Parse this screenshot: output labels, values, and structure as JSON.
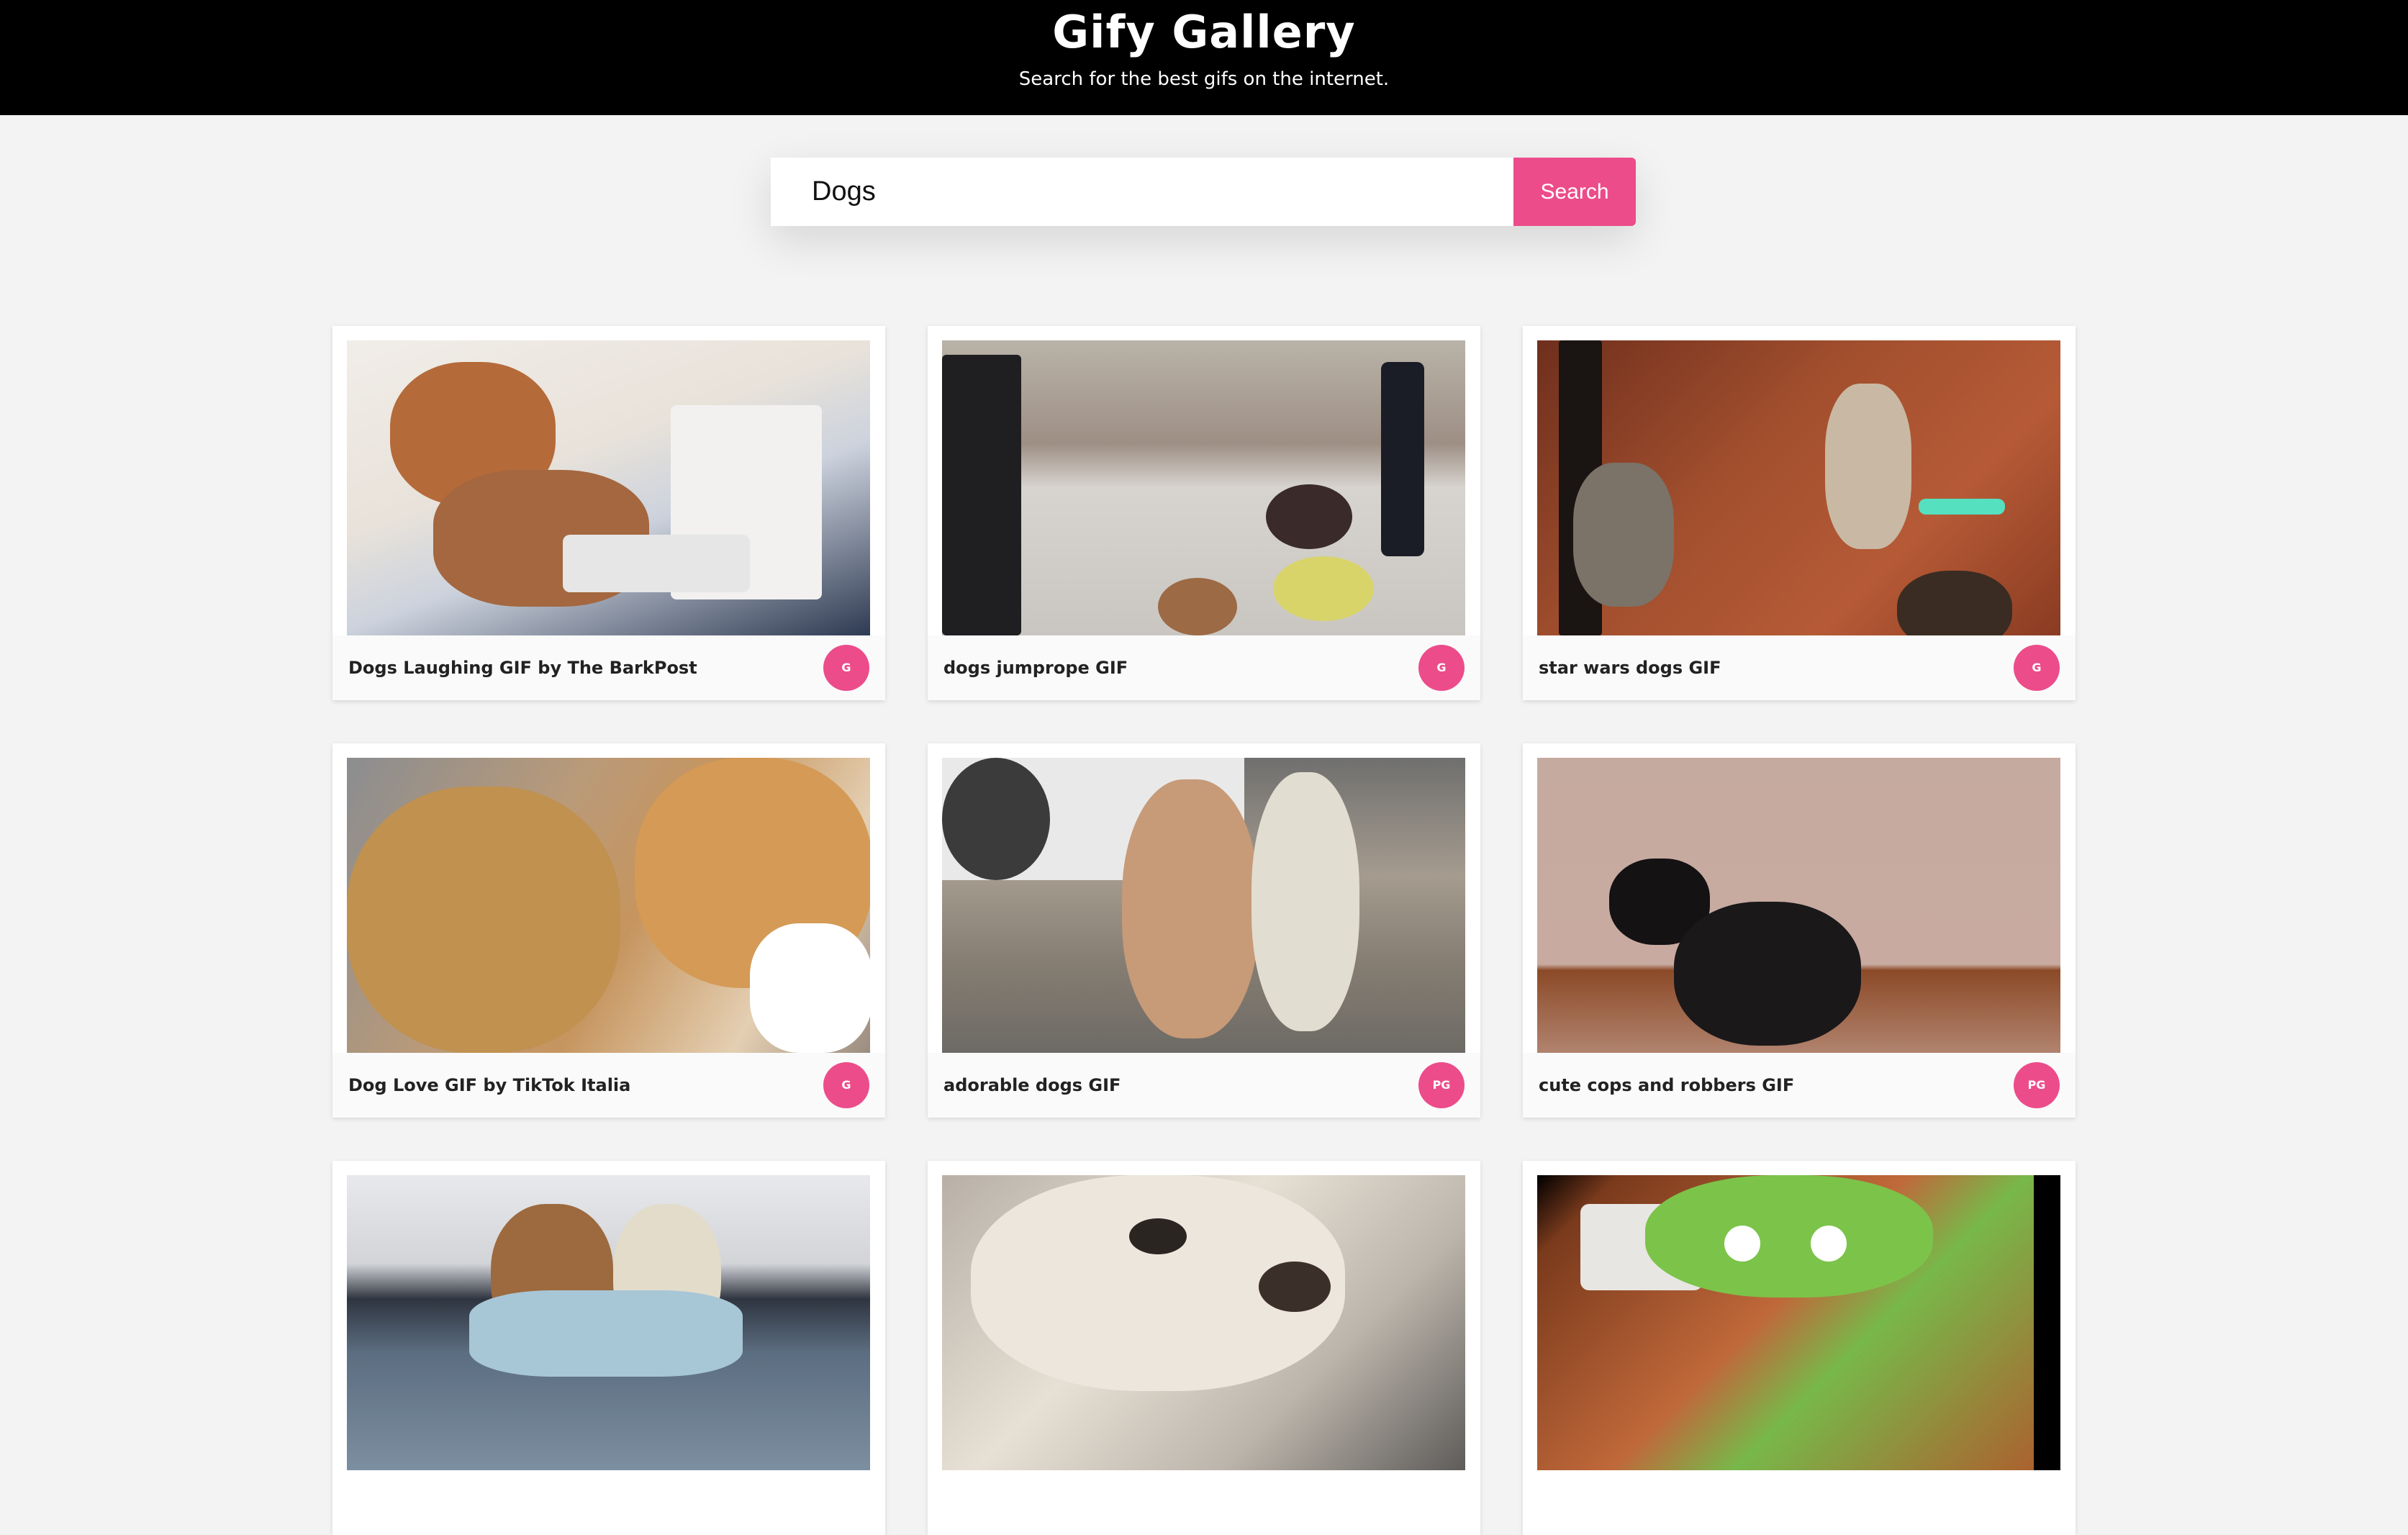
{
  "header": {
    "title": "Gify Gallery",
    "subtitle": "Search for the best gifs on the internet."
  },
  "search": {
    "value": "Dogs",
    "placeholder": "",
    "button_label": "Search"
  },
  "results": [
    {
      "caption": "Dogs Laughing GIF by The BarkPost",
      "rating": "G"
    },
    {
      "caption": "dogs jumprope GIF",
      "rating": "G"
    },
    {
      "caption": "star wars dogs GIF",
      "rating": "G"
    },
    {
      "caption": "Dog Love GIF by TikTok Italia",
      "rating": "G"
    },
    {
      "caption": "adorable dogs GIF",
      "rating": "PG"
    },
    {
      "caption": "cute cops and robbers GIF",
      "rating": "PG"
    },
    {
      "caption": "",
      "rating": ""
    },
    {
      "caption": "",
      "rating": ""
    },
    {
      "caption": "",
      "rating": ""
    }
  ],
  "colors": {
    "accent": "#ec4c8a",
    "header_bg": "#000000",
    "page_bg": "#f3f3f3"
  }
}
